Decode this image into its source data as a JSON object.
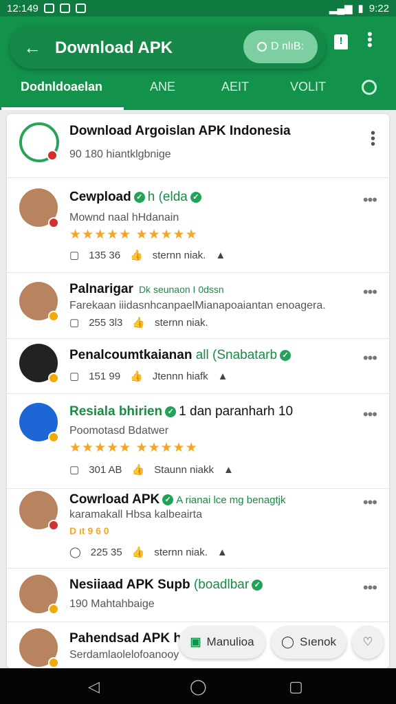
{
  "status_bar": {
    "time": "12:149",
    "right_time": "9:22"
  },
  "app_bar": {
    "back_icon": "back-arrow-icon",
    "title": "Download APK",
    "search_chip": "D nlıB:",
    "tabs": [
      "Dodnldoaelan",
      "ANE",
      "AEIT",
      "VOLIT"
    ],
    "active_tab": 0,
    "accent": "#13924c"
  },
  "header_card": {
    "title": "Download Argoislan APK Indonesia",
    "subtitle": "90  180  hiantklgbnige"
  },
  "posts": [
    {
      "name": "Cewpload",
      "suffix": "h (elda",
      "description": "Mownd naal  hHdanain",
      "rating_stars": "★★★★★ ★★★★★",
      "stats": [
        "135  36",
        "sternn niak."
      ],
      "badge_color": "#d32f2f"
    },
    {
      "name": "Palnarigar",
      "suffix": "Dk seunaon I 0dssn",
      "description": "Farekaan iiidasnhcanpaelMianapoaiantan enoagera.",
      "stats": [
        "255  3l3",
        "sternn niak."
      ],
      "badge_color": "#f2a900"
    },
    {
      "name": "Penalcoumtkaianan",
      "suffix": "all (Snabatarb",
      "stats": [
        "151  99",
        "Jtennn hiafk"
      ],
      "badge_color": "#f2a900"
    },
    {
      "name": "Resiala bhirien",
      "suffix": "1 dan paranharh",
      "extra": "10",
      "description": "Poomotasd Bdatwer",
      "rating_stars": "★★★★★ ★★★★★",
      "stats": [
        "301  AB",
        "Staunn niakk"
      ],
      "badge_color": "#f2a900"
    },
    {
      "name": "Cowrload APK",
      "suffix": "A rianai lce mg benagtjk",
      "description": "karamakall Hbsa kalbeairta",
      "extra": "D ıt 9 6 0",
      "stats": [
        "225  35",
        "sternn niak."
      ],
      "badge_color": "#d32f2f"
    },
    {
      "name": "Nesiiaad APK Supb",
      "suffix": "(boadlbar",
      "description": "190  Mahtahbaige",
      "badge_color": "#f2a900"
    },
    {
      "name": "Pahendsad APK hiar",
      "description": "Serdamlaolelofoanooy",
      "badge_color": "#f2a900"
    }
  ],
  "bottom_actions": {
    "left_label": "Manulioa",
    "middle_label": "Sıenok",
    "left_icon": "message-square-icon",
    "middle_icon": "chat-bubble-icon",
    "right_icon": "heart-outline-icon"
  }
}
